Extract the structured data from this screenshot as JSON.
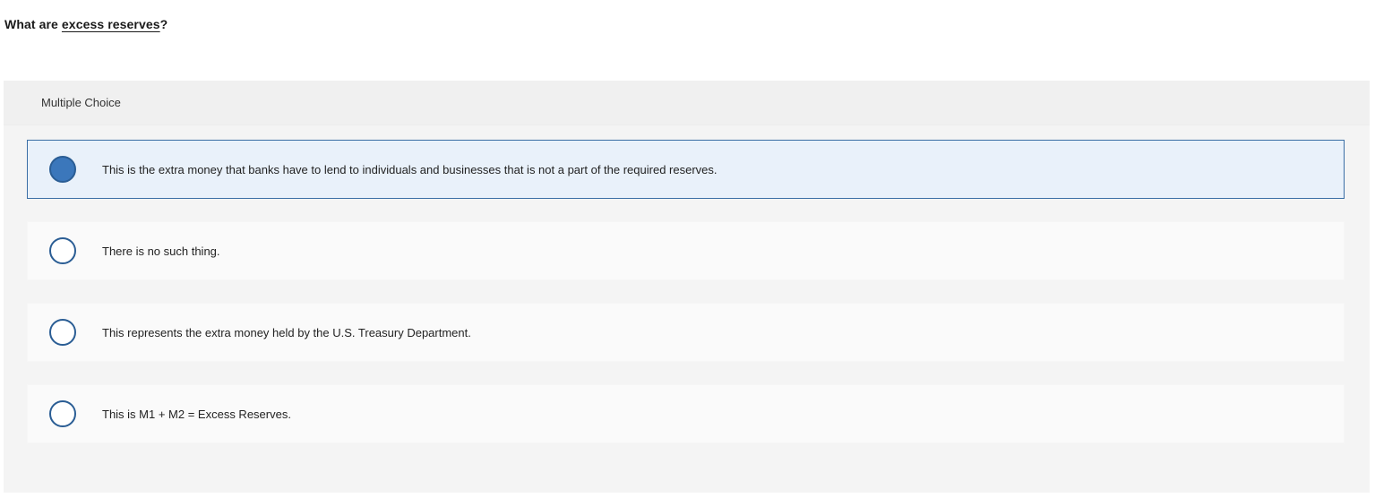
{
  "question": {
    "prefix": "What are ",
    "term": "excess reserves",
    "suffix": "?"
  },
  "mc": {
    "header_label": "Multiple Choice",
    "selected_index": 0,
    "options": [
      {
        "label": "This is the extra money that banks have to lend to individuals and businesses that is not a part of the required reserves.",
        "selected": true
      },
      {
        "label": "There is no such thing.",
        "selected": false
      },
      {
        "label": "This represents the extra money held by the U.S. Treasury Department.",
        "selected": false
      },
      {
        "label": "This is M1 + M2 = Excess Reserves.",
        "selected": false
      }
    ]
  },
  "colors": {
    "selected_background": "#e9f1fa",
    "selected_border": "#3a6ea5",
    "radio_fill": "#3b77bb",
    "panel_background": "#f4f4f4"
  }
}
